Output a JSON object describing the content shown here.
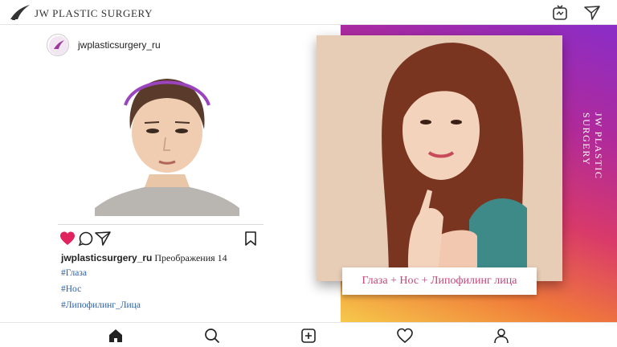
{
  "header": {
    "brand": "JW PLASTIC SURGERY",
    "icons": [
      "jw-logo-icon",
      "igtv-icon",
      "direct-send-icon"
    ]
  },
  "post": {
    "username": "jwplasticsurgery_ru",
    "caption_user": "jwplasticsurgery_ru",
    "caption_text": "Преображения 14",
    "hashtags": [
      "#Глаза",
      "#Нос",
      "#Липофилинг_Лица"
    ],
    "actions": [
      "heart-icon",
      "comment-icon",
      "share-icon",
      "bookmark-icon"
    ],
    "like_color": "#e0245e"
  },
  "promo": {
    "vertical_text": "JW PLASTIC SURGERY",
    "label": "Глаза + Нос + Липофилинг лица"
  },
  "bottom_nav": [
    "home-icon",
    "search-icon",
    "add-post-icon",
    "activity-heart-icon",
    "profile-icon"
  ]
}
